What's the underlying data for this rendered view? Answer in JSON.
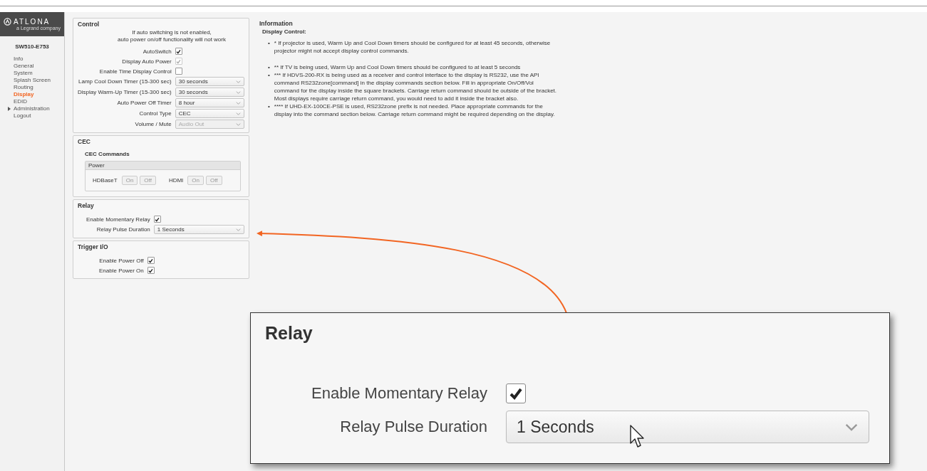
{
  "sidebar": {
    "logo": {
      "name": "ATLONA",
      "tagline": "a Legrand company"
    },
    "device": "SW510-E753",
    "items": [
      {
        "label": "Info",
        "selected": false,
        "kind": "link"
      },
      {
        "label": "General",
        "selected": false,
        "kind": "link"
      },
      {
        "label": "System",
        "selected": false,
        "kind": "link"
      },
      {
        "label": "Splash Screen",
        "selected": false,
        "kind": "link"
      },
      {
        "label": "Routing",
        "selected": false,
        "kind": "link"
      },
      {
        "label": "Display",
        "selected": true,
        "kind": "link"
      },
      {
        "label": "EDID",
        "selected": false,
        "kind": "link"
      },
      {
        "label": "Administration",
        "selected": false,
        "kind": "group"
      },
      {
        "label": "Logout",
        "selected": false,
        "kind": "link"
      }
    ]
  },
  "control": {
    "title": "Control",
    "note": [
      "If auto switching is not enabled,",
      "auto power on/off functionality will not work"
    ],
    "rows": [
      {
        "label": "AutoSwitch",
        "kind": "checkbox",
        "checked": true,
        "disabled": false
      },
      {
        "label": "Display Auto Power",
        "kind": "checkbox",
        "checked": true,
        "disabled": true
      },
      {
        "label": "Enable Time Display Control",
        "kind": "checkbox",
        "checked": false,
        "disabled": false
      },
      {
        "label": "Lamp Cool Down Timer (15-300 sec)",
        "kind": "select",
        "value": "30 seconds",
        "disabled": false
      },
      {
        "label": "Display Warm-Up Timer (15-300 sec)",
        "kind": "select",
        "value": "30 seconds",
        "disabled": false
      },
      {
        "label": "Auto Power Off Timer",
        "kind": "select",
        "value": "8 hour",
        "disabled": false
      },
      {
        "label": "Control Type",
        "kind": "select",
        "value": "CEC",
        "disabled": false
      },
      {
        "label": "Volume / Mute",
        "kind": "select",
        "value": "Audio Out",
        "disabled": true
      }
    ]
  },
  "cec": {
    "title": "CEC",
    "subtitle": "CEC Commands",
    "group": "Power",
    "devices": [
      {
        "label": "HDBaseT",
        "buttons": [
          "On",
          "Off"
        ]
      },
      {
        "label": "HDMI",
        "buttons": [
          "On",
          "Off"
        ]
      }
    ]
  },
  "relay": {
    "title": "Relay",
    "rows": [
      {
        "label": "Enable Momentary Relay",
        "kind": "checkbox",
        "checked": true,
        "disabled": false
      },
      {
        "label": "Relay Pulse Duration",
        "kind": "select",
        "value": "1 Seconds",
        "disabled": false
      }
    ]
  },
  "trigger": {
    "title": "Trigger I/O",
    "rows": [
      {
        "label": "Enable Power Off",
        "kind": "checkbox",
        "checked": true,
        "disabled": false
      },
      {
        "label": "Enable Power On",
        "kind": "checkbox",
        "checked": true,
        "disabled": false
      }
    ]
  },
  "information": {
    "title": "Information",
    "subtitle": "Display Control:",
    "items": [
      {
        "bullet": "•",
        "text": "* If projector is used, Warm Up and Cool Down timers should be configured for at least 45 seconds, otherwise projector might not accept display control commands."
      },
      {
        "bullet": "•",
        "text": "** If TV is being used, Warm Up and Cool Down timers should be configured to at least 5 seconds"
      },
      {
        "bullet": "•",
        "text": "*** If HDVS-200-RX is being used as a receiver and control interface to the display is RS232, use the API command RS232zone[command] in the display commands section below. Fill in appropriate On/Off/Vol command for the display inside the square brackets. Carriage return command should be outside of the bracket. Most displays require carriage return command, you would need to add it inside the bracket also."
      },
      {
        "bullet": "•",
        "text": "**** If UHD-EX-100CE-PSE is used, RS232zone prefix is not needed. Place appropriate commands for the display into the command section below. Carriage return command might be required depending on the display."
      }
    ]
  },
  "callout": {
    "title": "Relay",
    "rows": [
      {
        "label": "Enable Momentary Relay",
        "kind": "checkbox",
        "checked": true,
        "disabled": false
      },
      {
        "label": "Relay Pulse Duration",
        "kind": "select",
        "value": "1 Seconds",
        "disabled": false
      }
    ]
  }
}
